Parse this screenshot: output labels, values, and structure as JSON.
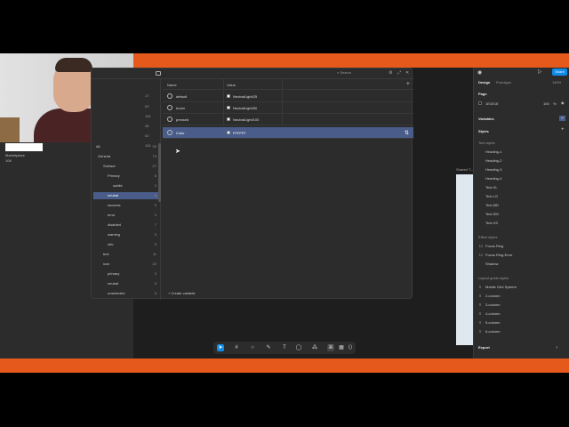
{
  "header": {
    "share_label": "Share",
    "zoom": "140%"
  },
  "left_panel": {
    "file_label": "Marketplace",
    "file_sub": "106"
  },
  "modal": {
    "search_placeholder": "Search",
    "collection_counts": [
      "17",
      "63",
      "115",
      "45",
      "62",
      "115"
    ],
    "groups": [
      {
        "label": "All",
        "count": "93"
      },
      {
        "label": "General",
        "count": "73"
      },
      {
        "label": "Surface",
        "count": "27"
      },
      {
        "label": "Primary",
        "count": "8"
      },
      {
        "label": "subtle",
        "count": "3"
      },
      {
        "label": "neutral",
        "count": "3"
      },
      {
        "label": "success",
        "count": "3"
      },
      {
        "label": "error",
        "count": "3"
      },
      {
        "label": "disabled",
        "count": "7"
      },
      {
        "label": "warning",
        "count": "3"
      },
      {
        "label": "info",
        "count": "3"
      },
      {
        "label": "text",
        "count": "11"
      },
      {
        "label": "icon",
        "count": "22"
      },
      {
        "label": "primary",
        "count": "3"
      },
      {
        "label": "neutral",
        "count": "3"
      },
      {
        "label": "unselected",
        "count": "3"
      }
    ],
    "columns": {
      "name": "Name",
      "value": "Value"
    },
    "variables": [
      {
        "name": "default",
        "value": "NeutralLight/25"
      },
      {
        "name": "hover",
        "value": "NeutralLight/50"
      },
      {
        "name": "pressed",
        "value": "NeutralLight/100"
      },
      {
        "name": "Color",
        "value": "FFFFFF"
      }
    ],
    "create_label": "Create variable"
  },
  "canvas": {
    "frame_label": "Shared T..."
  },
  "right_panel": {
    "tabs": [
      "Design",
      "Prototype"
    ],
    "page_heading": "Page",
    "page_color": "1E1E1E",
    "page_opacity": "100",
    "page_unit": "%",
    "variables_heading": "Variables",
    "styles_heading": "Styles",
    "text_styles_heading": "Text styles",
    "text_styles": [
      "Heading-1",
      "Heading-2",
      "Heading-3",
      "Heading-4",
      "Text-XL",
      "Text-LG",
      "Text-MD",
      "Text-SM",
      "Text-XS"
    ],
    "effect_styles_heading": "Effect styles",
    "effect_styles": [
      "Focus Ring",
      "Focus Ring-Error",
      "Shadow"
    ],
    "grid_styles_heading": "Layout guide styles",
    "grid_styles": [
      "Mobile Grid System",
      "2-column",
      "3-column",
      "4-column",
      "5-column",
      "6-column"
    ],
    "export_label": "Export",
    "help_label": "?"
  }
}
